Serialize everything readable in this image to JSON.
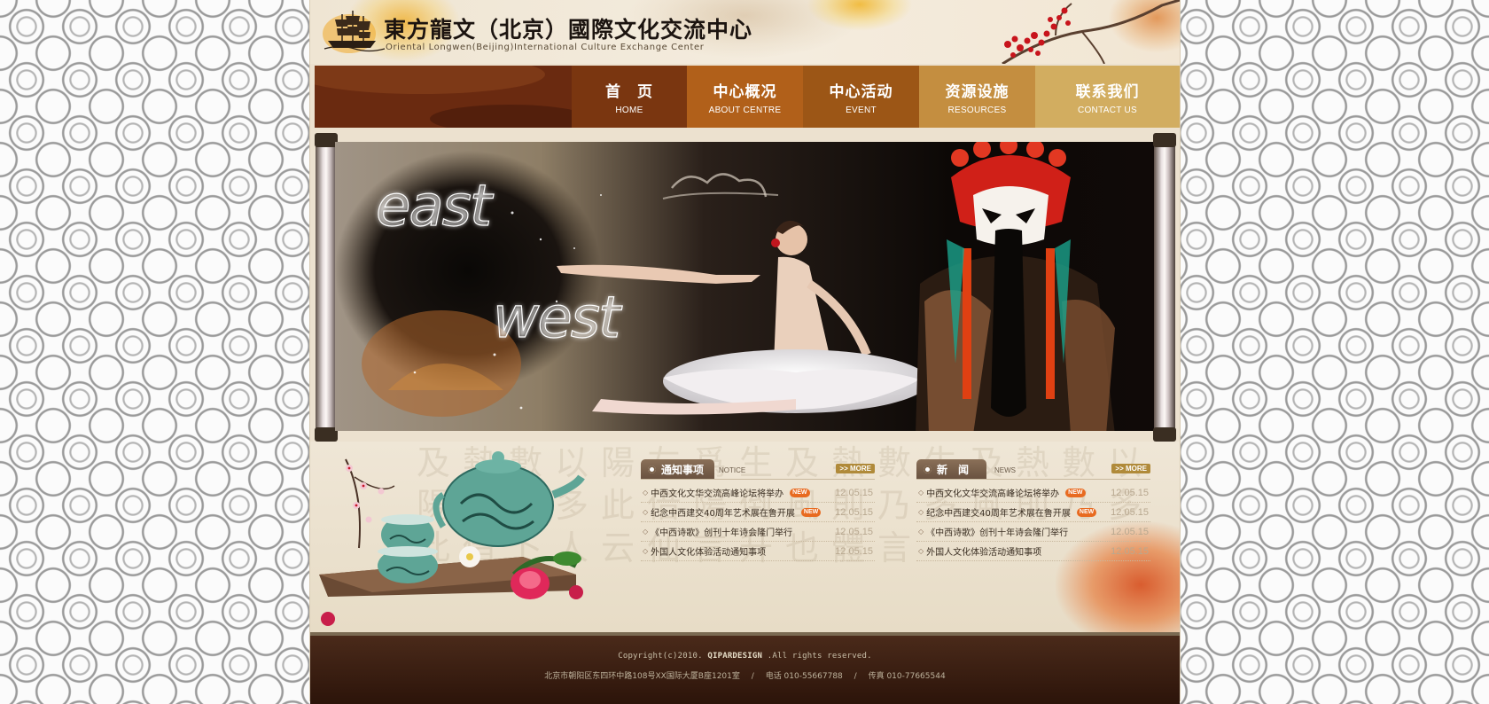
{
  "header": {
    "title": "東方龍文（北京）國際文化交流中心",
    "subtitle": "Oriental Longwen(Beijing)International Culture Exchange Center"
  },
  "nav": {
    "items": [
      {
        "cn": "首　页",
        "en": "HOME",
        "color": "#7a3610"
      },
      {
        "cn": "中心概况",
        "en": "ABOUT CENTRE",
        "color": "#b1601a"
      },
      {
        "cn": "中心活动",
        "en": "EVENT",
        "color": "#9c5616"
      },
      {
        "cn": "资源设施",
        "en": "RESOURCES",
        "color": "#c48e40"
      },
      {
        "cn": "联系我们",
        "en": "CONTACT US",
        "color": "#d2ad60"
      }
    ]
  },
  "banner": {
    "word_left": "east",
    "word_right": "west"
  },
  "notice": {
    "title": "通知事项",
    "en": "NOTICE",
    "more": ">> MORE",
    "items": [
      {
        "title": "中西文化文华交流高峰论坛将举办",
        "date": "12.05.15",
        "is_new": true
      },
      {
        "title": "纪念中西建交40周年艺术展在鲁开展",
        "date": "12.05.15",
        "is_new": true
      },
      {
        "title": "《中西诗歌》创刊十年诗会隆门举行",
        "date": "12.05.15",
        "is_new": false
      },
      {
        "title": "外国人文化体验活动通知事项",
        "date": "12.05.15",
        "is_new": false
      }
    ]
  },
  "news": {
    "title": "新　闻",
    "en": "NEWS",
    "more": ">> MORE",
    "items": [
      {
        "title": "中西文化文华交流高峰论坛将举办",
        "date": "12.05.15",
        "is_new": true
      },
      {
        "title": "纪念中西建交40周年艺术展在鲁开展",
        "date": "12.05.15",
        "is_new": true
      },
      {
        "title": "《中西诗歌》创刊十年诗会隆门举行",
        "date": "12.05.15",
        "is_new": false
      },
      {
        "title": "外国人文化体验活动通知事项",
        "date": "12.05.15",
        "is_new": false
      }
    ]
  },
  "new_badge": "NEW",
  "calligraphy_bg": "及熱數以陽左爲生及熱數生及熱數以陽則乃多此借陽倒風則乃多風則乃多此借卜人云仙言升也體言",
  "footer": {
    "copyright_prefix": "Copyright(c)2010.",
    "copyright_brand": "QIPARDESIGN",
    "copyright_suffix": ".All rights reserved.",
    "address": "北京市朝阳区东四环中路108号XX国际大厦B座1201室",
    "phone": "电话 010-55667788",
    "fax": "传真 010-77665544",
    "separator": "/"
  }
}
